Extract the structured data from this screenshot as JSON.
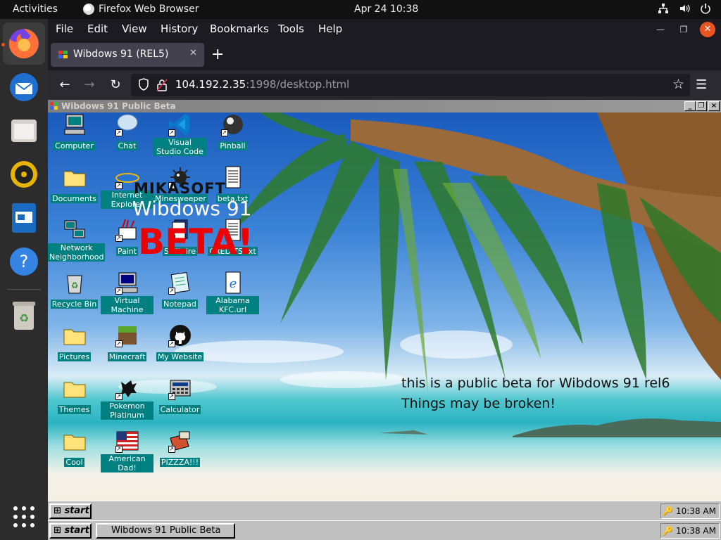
{
  "gnome": {
    "activities": "Activities",
    "app_name": "Firefox Web Browser",
    "clock": "Apr 24  10:38"
  },
  "dock": {
    "items": [
      "firefox-icon",
      "thunderbird-icon",
      "files-icon",
      "rhythmbox-icon",
      "libreoffice-impress-icon",
      "help-icon",
      "trash-icon",
      "app-grid-icon"
    ]
  },
  "firefox": {
    "menu": [
      "File",
      "Edit",
      "View",
      "History",
      "Bookmarks",
      "Tools",
      "Help"
    ],
    "tab_title": "Wibdows 91 (REL5)",
    "url_host": "104.192.2.35",
    "url_rest": ":1998/desktop.html"
  },
  "win9x": {
    "window_title": "Wibdows 91 Public Beta",
    "icons": [
      {
        "label": "Computer",
        "shortcut": false
      },
      {
        "label": "Chat",
        "shortcut": true
      },
      {
        "label": "Visual Studio Code",
        "shortcut": true
      },
      {
        "label": "Pinball",
        "shortcut": true
      },
      {
        "label": "Documents",
        "shortcut": false
      },
      {
        "label": "Internet Explorer",
        "shortcut": true
      },
      {
        "label": "Minesweeper",
        "shortcut": true
      },
      {
        "label": "beta.txt",
        "shortcut": false
      },
      {
        "label": "Network Neighborhood",
        "shortcut": false
      },
      {
        "label": "Paint",
        "shortcut": true
      },
      {
        "label": "Solitaire",
        "shortcut": true
      },
      {
        "label": "CREDITS.txt",
        "shortcut": false
      },
      {
        "label": "Recycle Bin",
        "shortcut": false
      },
      {
        "label": "Virtual Machine",
        "shortcut": true
      },
      {
        "label": "Notepad",
        "shortcut": true
      },
      {
        "label": "Alabama KFC.url",
        "shortcut": false
      },
      {
        "label": "Pictures",
        "shortcut": false
      },
      {
        "label": "Minecraft",
        "shortcut": true
      },
      {
        "label": "My Website",
        "shortcut": true
      },
      {
        "label": "Themes",
        "shortcut": false
      },
      {
        "label": "Pokemon Platinum",
        "shortcut": true
      },
      {
        "label": "Calculator",
        "shortcut": true
      },
      {
        "label": "Cool",
        "shortcut": false
      },
      {
        "label": "American Dad!",
        "shortcut": true
      },
      {
        "label": "PIZZZA!!!",
        "shortcut": true
      }
    ],
    "logo": {
      "maker": "MIKASOFT",
      "product": "Wibdows 91",
      "tag": "BETA!"
    },
    "message_line1": "this is a public beta for Wibdows 91 rel6",
    "message_line2": "Things may be broken!",
    "start_label": "start",
    "clock": "10:38 AM",
    "taskbar_window": "Wibdows 91 Public Beta"
  }
}
